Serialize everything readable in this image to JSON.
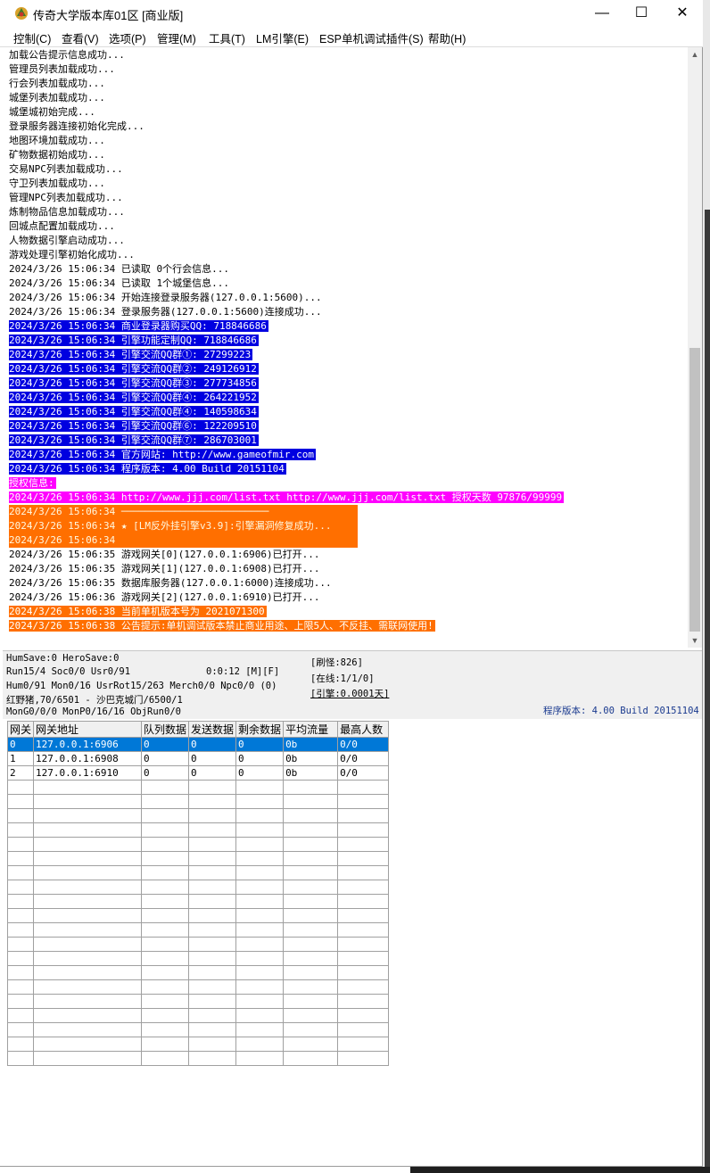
{
  "window": {
    "title": "传奇大学版本库01区 [商业版]",
    "min_glyph": "—",
    "max_glyph": "☐",
    "close_glyph": "✕"
  },
  "menu": [
    "控制(C)",
    "查看(V)",
    "选项(P)",
    "管理(M)",
    "工具(T)",
    "LM引擎(E)",
    "ESP单机调试插件(S)",
    "帮助(H)"
  ],
  "colors": {
    "blue_hl": "#0000e0",
    "magenta_hl": "#ff00ff",
    "orange_hl": "#ff6f00",
    "selection": "#0078d7"
  },
  "log": [
    {
      "text": "加载公告提示信息成功...",
      "hl": ""
    },
    {
      "text": "管理员列表加载成功...",
      "hl": ""
    },
    {
      "text": "行会列表加载成功...",
      "hl": ""
    },
    {
      "text": "城堡列表加载成功...",
      "hl": ""
    },
    {
      "text": "城堡城初始完成...",
      "hl": ""
    },
    {
      "text": "登录服务器连接初始化完成...",
      "hl": ""
    },
    {
      "text": "地图环境加载成功...",
      "hl": ""
    },
    {
      "text": "矿物数据初始成功...",
      "hl": ""
    },
    {
      "text": "交易NPC列表加载成功...",
      "hl": ""
    },
    {
      "text": "守卫列表加载成功...",
      "hl": ""
    },
    {
      "text": "管理NPC列表加载成功...",
      "hl": ""
    },
    {
      "text": "炼制物品信息加载成功...",
      "hl": ""
    },
    {
      "text": "回城点配置加载成功...",
      "hl": ""
    },
    {
      "text": "人物数据引擎启动成功...",
      "hl": ""
    },
    {
      "text": "游戏处理引擎初始化成功...",
      "hl": ""
    },
    {
      "text": "2024/3/26 15:06:34 已读取 0个行会信息...",
      "hl": ""
    },
    {
      "text": "2024/3/26 15:06:34 已读取 1个城堡信息...",
      "hl": ""
    },
    {
      "text": "2024/3/26 15:06:34 开始连接登录服务器(127.0.0.1:5600)...",
      "hl": ""
    },
    {
      "text": "2024/3/26 15:06:34 登录服务器(127.0.0.1:5600)连接成功...",
      "hl": ""
    },
    {
      "text": "2024/3/26 15:06:34 商业登录器购买QQ: 718846686",
      "hl": "blue"
    },
    {
      "text": "2024/3/26 15:06:34 引擎功能定制QQ: 718846686",
      "hl": "blue"
    },
    {
      "text": "2024/3/26 15:06:34 引擎交流QQ群①: 27299223",
      "hl": "blue"
    },
    {
      "text": "2024/3/26 15:06:34 引擎交流QQ群②: 249126912",
      "hl": "blue"
    },
    {
      "text": "2024/3/26 15:06:34 引擎交流QQ群③: 277734856",
      "hl": "blue"
    },
    {
      "text": "2024/3/26 15:06:34 引擎交流QQ群④: 264221952",
      "hl": "blue"
    },
    {
      "text": "2024/3/26 15:06:34 引擎交流QQ群④: 140598634",
      "hl": "blue"
    },
    {
      "text": "2024/3/26 15:06:34 引擎交流QQ群⑥: 122209510",
      "hl": "blue"
    },
    {
      "text": "2024/3/26 15:06:34 引擎交流QQ群⑦: 286703001",
      "hl": "blue"
    },
    {
      "text": "2024/3/26 15:06:34 官方网站: http://www.gameofmir.com",
      "hl": "blue"
    },
    {
      "text": "2024/3/26 15:06:34 程序版本: 4.00 Build 20151104",
      "hl": "blue"
    },
    {
      "text": "授权信息:",
      "hl": "magenta"
    },
    {
      "text": "2024/3/26 15:06:34 http://www.jjj.com/list.txt http://www.jjj.com/list.txt 授权天数 97876/99999",
      "hl": "magenta"
    },
    {
      "text": "2024/3/26 15:06:34 ─────────────────────────",
      "hl": "orange"
    },
    {
      "text": "2024/3/26 15:06:34 ★ [LM反外挂引擎v3.9]:引擎漏洞修复成功...   ",
      "hl": "orange"
    },
    {
      "text": "2024/3/26 15:06:34                          ",
      "hl": "orange"
    },
    {
      "text": "2024/3/26 15:06:35 游戏网关[0](127.0.0.1:6906)已打开...",
      "hl": ""
    },
    {
      "text": "2024/3/26 15:06:35 游戏网关[1](127.0.0.1:6908)已打开...",
      "hl": ""
    },
    {
      "text": "2024/3/26 15:06:35 数据库服务器(127.0.0.1:6000)连接成功...",
      "hl": ""
    },
    {
      "text": "2024/3/26 15:06:36 游戏网关[2](127.0.0.1:6910)已打开...",
      "hl": ""
    },
    {
      "text": "2024/3/26 15:06:38 当前单机版本号为 2021071300",
      "hl": "orange"
    },
    {
      "text": "2024/3/26 15:06:38 公告提示:单机调试版本禁止商业用途、上限5人、不反挂、需联网使用!",
      "hl": "orange"
    }
  ],
  "status": {
    "line1": "HumSave:0 HeroSave:0",
    "line2": "Run15/4 Soc0/0 Usr0/91",
    "time": "0:0:12 [M][F]",
    "line3": "Hum0/91 Mon0/16 UsrRot15/263 Merch0/0 Npc0/0 (0)",
    "line4": "红野猪,70/6501 - 沙巴克城门/6500/1",
    "line5": "MonG0/0/0 MonP0/16/16 ObjRun0/0",
    "refresh": "[刷怪:826]",
    "online": "[在线:1/1/0]",
    "engine": "[引擎:0.0001天]",
    "version": "程序版本: 4.00 Build 20151104"
  },
  "grid": {
    "headers": [
      "网关",
      "网关地址",
      "队列数据",
      "发送数据",
      "剩余数据",
      "平均流量",
      "最高人数"
    ],
    "rows": [
      [
        "0",
        "127.0.0.1:6906",
        "0",
        "0",
        "0",
        "0b",
        "0/0"
      ],
      [
        "1",
        "127.0.0.1:6908",
        "0",
        "0",
        "0",
        "0b",
        "0/0"
      ],
      [
        "2",
        "127.0.0.1:6910",
        "0",
        "0",
        "0",
        "0b",
        "0/0"
      ]
    ],
    "empty_rows": 20
  }
}
